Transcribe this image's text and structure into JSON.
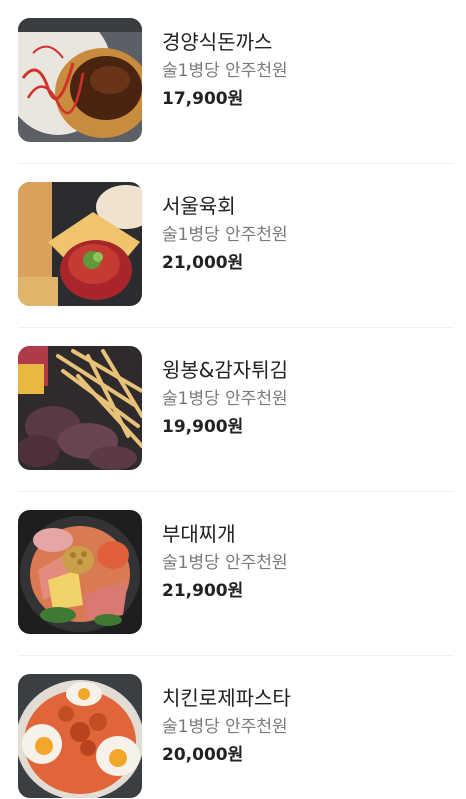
{
  "menu": {
    "items": [
      {
        "name": "경양식돈까스",
        "description": "술1병당 안주천원",
        "price": "17,900원",
        "image_icon": "pork-cutlet-photo"
      },
      {
        "name": "서울육회",
        "description": "술1병당 안주천원",
        "price": "21,000원",
        "image_icon": "beef-tartare-photo"
      },
      {
        "name": "윙봉&감자튀김",
        "description": "술1병당 안주천원",
        "price": "19,900원",
        "image_icon": "wings-and-fries-photo"
      },
      {
        "name": "부대찌개",
        "description": "술1병당 안주천원",
        "price": "21,900원",
        "image_icon": "army-stew-photo"
      },
      {
        "name": "치킨로제파스타",
        "description": "술1병당 안주천원",
        "price": "20,000원",
        "image_icon": "rose-pasta-photo"
      }
    ]
  }
}
